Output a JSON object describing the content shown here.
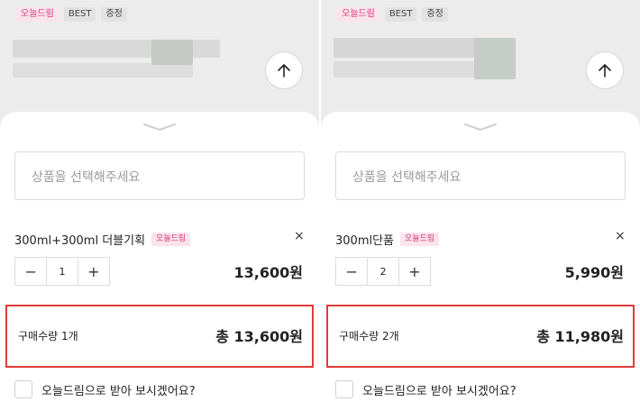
{
  "panels": [
    {
      "tags": [
        "오늘드림",
        "BEST",
        "증정"
      ],
      "placeholder": "상품을 선택해주세요",
      "option_name": "300ml+300ml 더블기획",
      "option_tag": "오늘드림",
      "remove": "×",
      "minus": "−",
      "quantity": "1",
      "plus": "+",
      "price": "13,600원",
      "qty_label": "구매수량 1개",
      "total": "총 13,600원",
      "pickup_label": "오늘드림으로 받아 보시겠어요?"
    },
    {
      "tags": [
        "오늘드림",
        "BEST",
        "증정"
      ],
      "placeholder": "상품을 선택해주세요",
      "option_name": "300ml단품",
      "option_tag": "오늘드림",
      "remove": "×",
      "minus": "−",
      "quantity": "2",
      "plus": "+",
      "price": "5,990원",
      "qty_label": "구매수량 2개",
      "total": "총 11,980원",
      "pickup_label": "오늘드림으로 받아 보시겠어요?"
    }
  ],
  "colors": {
    "accent_pink": "#d23a78",
    "highlight_red": "#e23a3a"
  },
  "icons": {
    "collapse": "chevron-down-icon",
    "scroll_up": "arrow-up-icon"
  }
}
